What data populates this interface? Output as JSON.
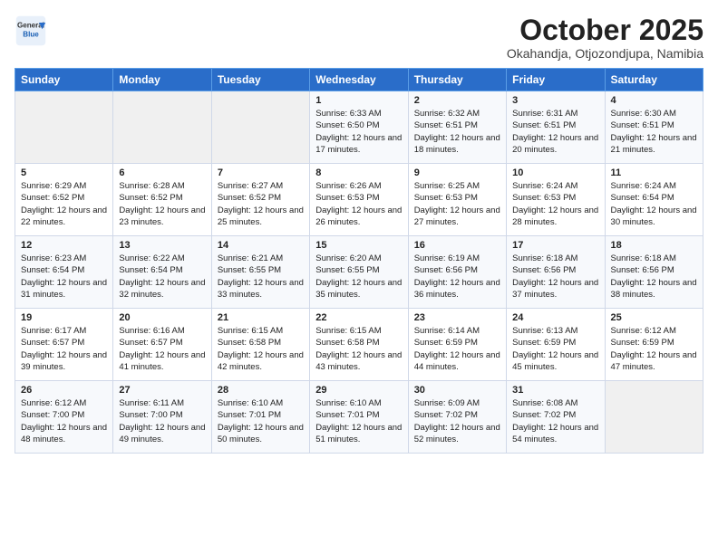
{
  "header": {
    "logo_general": "General",
    "logo_blue": "Blue",
    "title": "October 2025",
    "location": "Okahandja, Otjozondjupa, Namibia"
  },
  "weekdays": [
    "Sunday",
    "Monday",
    "Tuesday",
    "Wednesday",
    "Thursday",
    "Friday",
    "Saturday"
  ],
  "weeks": [
    [
      {
        "day": "",
        "info": ""
      },
      {
        "day": "",
        "info": ""
      },
      {
        "day": "",
        "info": ""
      },
      {
        "day": "1",
        "info": "Sunrise: 6:33 AM\nSunset: 6:50 PM\nDaylight: 12 hours\nand 17 minutes."
      },
      {
        "day": "2",
        "info": "Sunrise: 6:32 AM\nSunset: 6:51 PM\nDaylight: 12 hours\nand 18 minutes."
      },
      {
        "day": "3",
        "info": "Sunrise: 6:31 AM\nSunset: 6:51 PM\nDaylight: 12 hours\nand 20 minutes."
      },
      {
        "day": "4",
        "info": "Sunrise: 6:30 AM\nSunset: 6:51 PM\nDaylight: 12 hours\nand 21 minutes."
      }
    ],
    [
      {
        "day": "5",
        "info": "Sunrise: 6:29 AM\nSunset: 6:52 PM\nDaylight: 12 hours\nand 22 minutes."
      },
      {
        "day": "6",
        "info": "Sunrise: 6:28 AM\nSunset: 6:52 PM\nDaylight: 12 hours\nand 23 minutes."
      },
      {
        "day": "7",
        "info": "Sunrise: 6:27 AM\nSunset: 6:52 PM\nDaylight: 12 hours\nand 25 minutes."
      },
      {
        "day": "8",
        "info": "Sunrise: 6:26 AM\nSunset: 6:53 PM\nDaylight: 12 hours\nand 26 minutes."
      },
      {
        "day": "9",
        "info": "Sunrise: 6:25 AM\nSunset: 6:53 PM\nDaylight: 12 hours\nand 27 minutes."
      },
      {
        "day": "10",
        "info": "Sunrise: 6:24 AM\nSunset: 6:53 PM\nDaylight: 12 hours\nand 28 minutes."
      },
      {
        "day": "11",
        "info": "Sunrise: 6:24 AM\nSunset: 6:54 PM\nDaylight: 12 hours\nand 30 minutes."
      }
    ],
    [
      {
        "day": "12",
        "info": "Sunrise: 6:23 AM\nSunset: 6:54 PM\nDaylight: 12 hours\nand 31 minutes."
      },
      {
        "day": "13",
        "info": "Sunrise: 6:22 AM\nSunset: 6:54 PM\nDaylight: 12 hours\nand 32 minutes."
      },
      {
        "day": "14",
        "info": "Sunrise: 6:21 AM\nSunset: 6:55 PM\nDaylight: 12 hours\nand 33 minutes."
      },
      {
        "day": "15",
        "info": "Sunrise: 6:20 AM\nSunset: 6:55 PM\nDaylight: 12 hours\nand 35 minutes."
      },
      {
        "day": "16",
        "info": "Sunrise: 6:19 AM\nSunset: 6:56 PM\nDaylight: 12 hours\nand 36 minutes."
      },
      {
        "day": "17",
        "info": "Sunrise: 6:18 AM\nSunset: 6:56 PM\nDaylight: 12 hours\nand 37 minutes."
      },
      {
        "day": "18",
        "info": "Sunrise: 6:18 AM\nSunset: 6:56 PM\nDaylight: 12 hours\nand 38 minutes."
      }
    ],
    [
      {
        "day": "19",
        "info": "Sunrise: 6:17 AM\nSunset: 6:57 PM\nDaylight: 12 hours\nand 39 minutes."
      },
      {
        "day": "20",
        "info": "Sunrise: 6:16 AM\nSunset: 6:57 PM\nDaylight: 12 hours\nand 41 minutes."
      },
      {
        "day": "21",
        "info": "Sunrise: 6:15 AM\nSunset: 6:58 PM\nDaylight: 12 hours\nand 42 minutes."
      },
      {
        "day": "22",
        "info": "Sunrise: 6:15 AM\nSunset: 6:58 PM\nDaylight: 12 hours\nand 43 minutes."
      },
      {
        "day": "23",
        "info": "Sunrise: 6:14 AM\nSunset: 6:59 PM\nDaylight: 12 hours\nand 44 minutes."
      },
      {
        "day": "24",
        "info": "Sunrise: 6:13 AM\nSunset: 6:59 PM\nDaylight: 12 hours\nand 45 minutes."
      },
      {
        "day": "25",
        "info": "Sunrise: 6:12 AM\nSunset: 6:59 PM\nDaylight: 12 hours\nand 47 minutes."
      }
    ],
    [
      {
        "day": "26",
        "info": "Sunrise: 6:12 AM\nSunset: 7:00 PM\nDaylight: 12 hours\nand 48 minutes."
      },
      {
        "day": "27",
        "info": "Sunrise: 6:11 AM\nSunset: 7:00 PM\nDaylight: 12 hours\nand 49 minutes."
      },
      {
        "day": "28",
        "info": "Sunrise: 6:10 AM\nSunset: 7:01 PM\nDaylight: 12 hours\nand 50 minutes."
      },
      {
        "day": "29",
        "info": "Sunrise: 6:10 AM\nSunset: 7:01 PM\nDaylight: 12 hours\nand 51 minutes."
      },
      {
        "day": "30",
        "info": "Sunrise: 6:09 AM\nSunset: 7:02 PM\nDaylight: 12 hours\nand 52 minutes."
      },
      {
        "day": "31",
        "info": "Sunrise: 6:08 AM\nSunset: 7:02 PM\nDaylight: 12 hours\nand 54 minutes."
      },
      {
        "day": "",
        "info": ""
      }
    ]
  ]
}
